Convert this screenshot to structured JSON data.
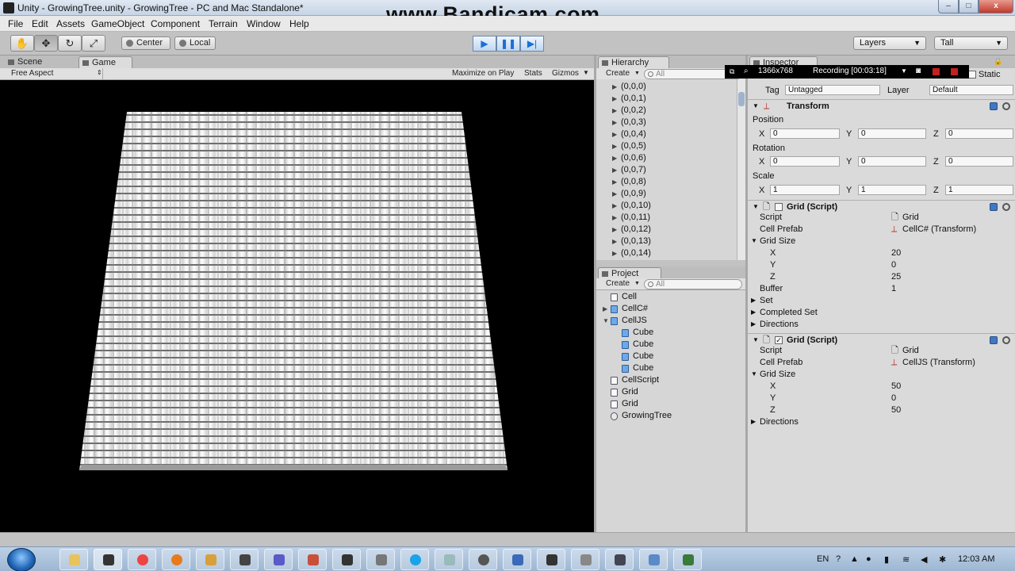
{
  "window": {
    "title": "Unity - GrowingTree.unity - GrowingTree - PC and Mac Standalone*",
    "watermark": "www.Bandicam.com",
    "controls": {
      "minimize": "–",
      "maximize": "□",
      "close": "x"
    }
  },
  "menu": [
    "File",
    "Edit",
    "Assets",
    "GameObject",
    "Component",
    "Terrain",
    "Window",
    "Help"
  ],
  "toolbar": {
    "tools": [
      "hand-icon",
      "move-icon",
      "rotate-icon",
      "scale-icon"
    ],
    "pivot_label": "Center",
    "space_label": "Local",
    "play_glyph": "▶",
    "pause_glyph": "❚❚",
    "step_glyph": "▶|",
    "layers_label": "Layers",
    "layout_label": "Tall"
  },
  "scene_tabs": {
    "scene": "Scene",
    "game": "Game"
  },
  "game": {
    "aspect": "Free Aspect",
    "maximize": "Maximize on Play",
    "stats": "Stats",
    "gizmos": "Gizmos"
  },
  "hierarchy": {
    "tab": "Hierarchy",
    "create": "Create",
    "search_placeholder": "All",
    "items": [
      "(0,0,0)",
      "(0,0,1)",
      "(0,0,2)",
      "(0,0,3)",
      "(0,0,4)",
      "(0,0,5)",
      "(0,0,6)",
      "(0,0,7)",
      "(0,0,8)",
      "(0,0,9)",
      "(0,0,10)",
      "(0,0,11)",
      "(0,0,12)",
      "(0,0,13)",
      "(0,0,14)"
    ]
  },
  "project": {
    "tab": "Project",
    "create": "Create",
    "search_placeholder": "All",
    "items": {
      "cell": "Cell",
      "cellcs": "CellC#",
      "celljs": "CellJS",
      "cube1": "Cube",
      "cube2": "Cube",
      "cube3": "Cube",
      "cube4": "Cube",
      "cellscript": "CellScript",
      "grid1": "Grid",
      "grid2": "Grid",
      "growingtree": "GrowingTree"
    }
  },
  "inspector": {
    "tab": "Inspector",
    "static_label": "Static",
    "tag_label": "Tag",
    "tag_value": "Untagged",
    "layer_label": "Layer",
    "layer_value": "Default",
    "transform": {
      "title": "Transform",
      "position_label": "Position",
      "rotation_label": "Rotation",
      "scale_label": "Scale",
      "x": "X",
      "y": "Y",
      "z": "Z",
      "position": [
        "0",
        "0",
        "0"
      ],
      "rotation": [
        "0",
        "0",
        "0"
      ],
      "scale": [
        "1",
        "1",
        "1"
      ]
    },
    "grid_cs": {
      "title": "Grid (Script)",
      "script_label": "Script",
      "script_value": "Grid",
      "prefab_label": "Cell Prefab",
      "prefab_value": "CellC# (Transform)",
      "gridsize_label": "Grid Size",
      "x_label": "X",
      "x_value": "20",
      "y_label": "Y",
      "y_value": "0",
      "z_label": "Z",
      "z_value": "25",
      "buffer_label": "Buffer",
      "buffer_value": "1",
      "set_label": "Set",
      "completed_label": "Completed Set",
      "directions_label": "Directions"
    },
    "grid_js": {
      "title": "Grid (Script)",
      "script_label": "Script",
      "script_value": "Grid",
      "prefab_label": "Cell Prefab",
      "prefab_value": "CellJS (Transform)",
      "gridsize_label": "Grid Size",
      "x_label": "X",
      "x_value": "50",
      "y_label": "Y",
      "y_value": "0",
      "z_label": "Z",
      "z_value": "50",
      "directions_label": "Directions"
    }
  },
  "recording": {
    "resolution": "1366x768",
    "status": "Recording [00:03:18]"
  },
  "taskbar": {
    "language": "EN",
    "time": "12:03 AM"
  }
}
